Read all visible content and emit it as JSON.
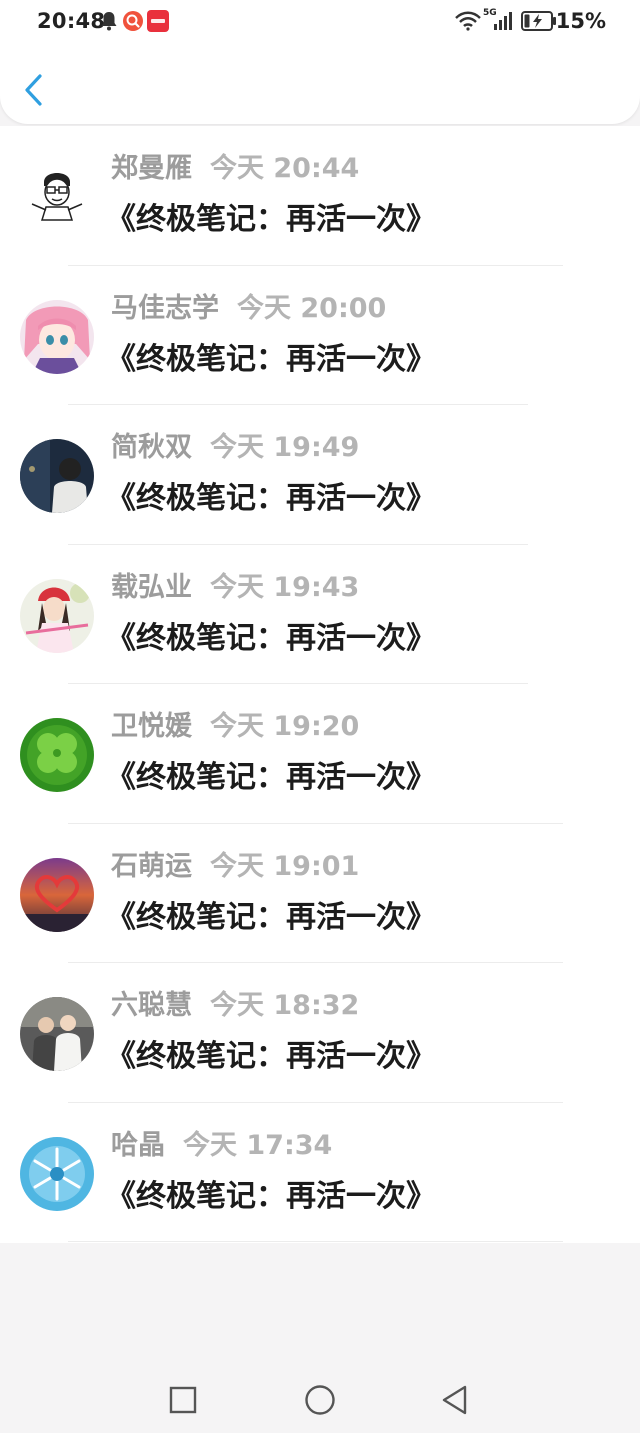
{
  "status_bar": {
    "time": "20:48",
    "network": "5G",
    "battery": "15%",
    "icons": [
      "bell-icon",
      "search-app-icon",
      "xiaohongshu-app-icon",
      "wifi-icon",
      "signal-icon",
      "battery-charging-icon"
    ]
  },
  "header": {
    "back_icon": "chevron-left-icon",
    "accent_color": "#2f9fe0"
  },
  "list": {
    "items": [
      {
        "name": "郑曼雁",
        "time": "今天 20:44",
        "title": "《终极笔记：再活一次》",
        "avatar": "cartoon-man-avatar"
      },
      {
        "name": "马佳志学",
        "time": "今天 20:00",
        "title": "《终极笔记：再活一次》",
        "avatar": "anime-girl-avatar"
      },
      {
        "name": "简秋双",
        "time": "今天 19:49",
        "title": "《终极笔记：再活一次》",
        "avatar": "boy-back-avatar"
      },
      {
        "name": "载弘业",
        "time": "今天 19:43",
        "title": "《终极笔记：再活一次》",
        "avatar": "girl-red-hat-avatar"
      },
      {
        "name": "卫悦媛",
        "time": "今天 19:20",
        "title": "《终极笔记：再活一次》",
        "avatar": "clover-avatar"
      },
      {
        "name": "石萌运",
        "time": "今天 19:01",
        "title": "《终极笔记：再活一次》",
        "avatar": "heart-sunset-avatar"
      },
      {
        "name": "六聪慧",
        "time": "今天 18:32",
        "title": "《终极笔记：再活一次》",
        "avatar": "couple-photo-avatar"
      },
      {
        "name": "哈晶",
        "time": "今天 17:34",
        "title": "《终极笔记：再活一次》",
        "avatar": "blue-snowflake-avatar"
      }
    ]
  },
  "nav_bar": {
    "recents_icon": "square-icon",
    "home_icon": "circle-icon",
    "back_icon": "triangle-back-icon"
  }
}
